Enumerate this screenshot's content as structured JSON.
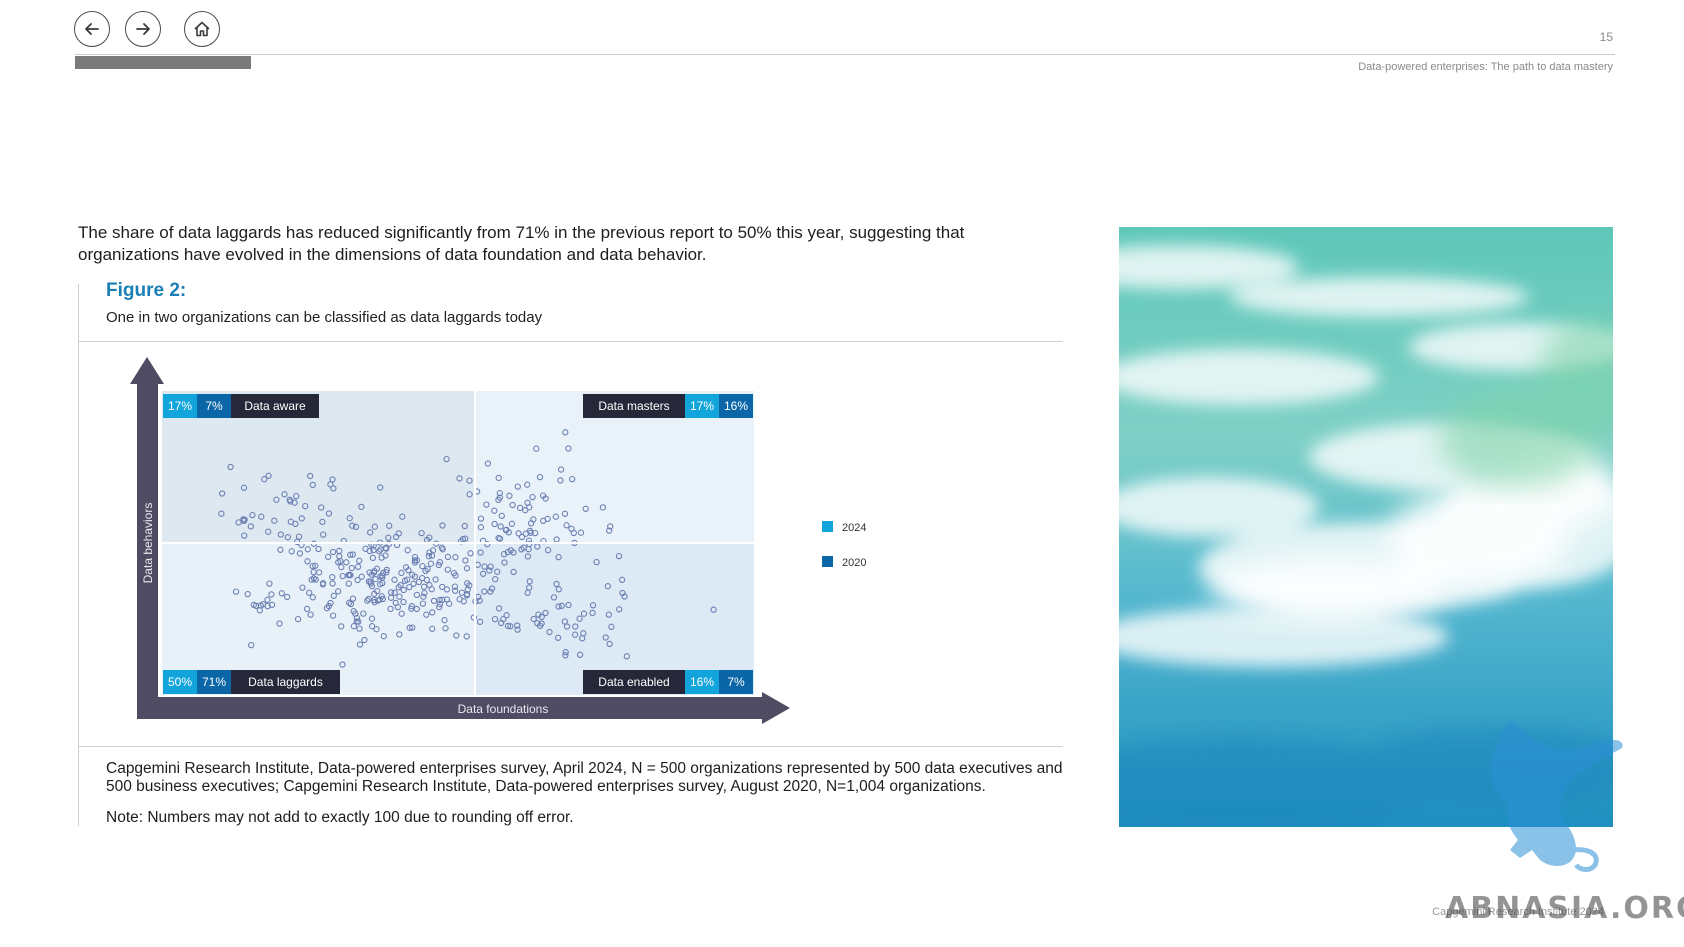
{
  "header": {
    "page_number": "15",
    "running_title": "Data-powered enterprises: The path to data mastery",
    "icons": [
      "back-arrow-icon",
      "forward-arrow-icon",
      "home-icon"
    ]
  },
  "intro_text": "The share of data laggards has reduced significantly from 71% in the previous report to 50% this year, suggesting that organizations have evolved in the dimensions of data foundation and data behavior.",
  "figure": {
    "title": "Figure 2:",
    "subtitle": "One in two organizations can be classified as data laggards today"
  },
  "chart_data": {
    "type": "scatter",
    "xlabel": "Data foundations",
    "ylabel": "Data behaviors",
    "legend": [
      "2024",
      "2020"
    ],
    "legend_position": "right",
    "colors": {
      "2024": "#12a5dc",
      "2020": "#0b66a8",
      "label_bg": "#27273a",
      "axis": "#4e4b63",
      "points": "#6b7fb3"
    },
    "quadrants": [
      {
        "name": "Data aware",
        "position": "top-left",
        "2024": "17%",
        "2020": "7%"
      },
      {
        "name": "Data masters",
        "position": "top-right",
        "2024": "17%",
        "2020": "16%"
      },
      {
        "name": "Data laggards",
        "position": "bottom-left",
        "2024": "50%",
        "2020": "71%"
      },
      {
        "name": "Data enabled",
        "position": "bottom-right",
        "2024": "16%",
        "2020": "7%"
      }
    ],
    "note": "Scatter of individual organization scores (approx. 500 points) across the four quadrants; unlabeled axes."
  },
  "source_text": "Capgemini Research Institute, Data-powered enterprises survey, April 2024, N = 500 organizations represented by 500 data executives and 500 business executives; Capgemini Research Institute, Data-powered enterprises survey, August 2020, N=1,004 organizations.",
  "note_text": "Note: Numbers may not add to exactly 100 due to rounding off error.",
  "footer": {
    "text": "Capgemini Research Institute 2024",
    "watermark": "ABNASIA.ORG"
  }
}
